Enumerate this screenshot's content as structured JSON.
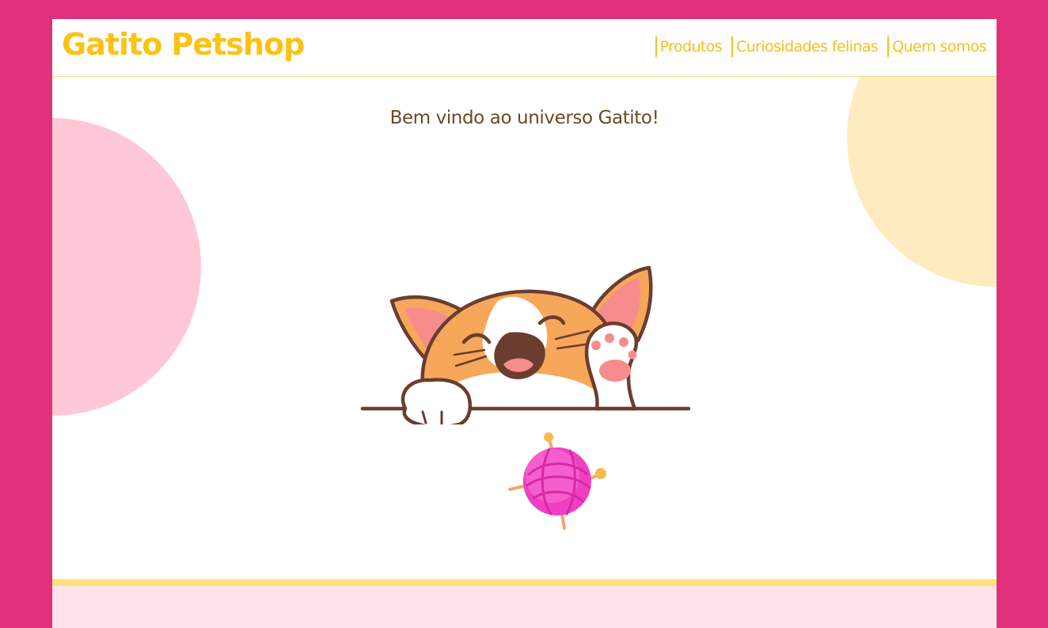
{
  "brand": {
    "name": "Gatito Petshop"
  },
  "nav": {
    "items": [
      {
        "label": "Produtos"
      },
      {
        "label": "Curiosidades felinas"
      },
      {
        "label": "Quem somos"
      }
    ]
  },
  "main": {
    "welcome": "Bem vindo ao universo Gatito!"
  },
  "colors": {
    "background": "#e2307b",
    "brand_yellow": "#fcc214",
    "heading_brown": "#6b4a23",
    "circle_pink": "#ffc8d6",
    "circle_yellow": "#feebc0",
    "footer_stripe": "#fde17b",
    "footer_bg": "#ffe3ea"
  },
  "illustrations": [
    "waving-cat-illustration",
    "yarn-ball-illustration"
  ]
}
